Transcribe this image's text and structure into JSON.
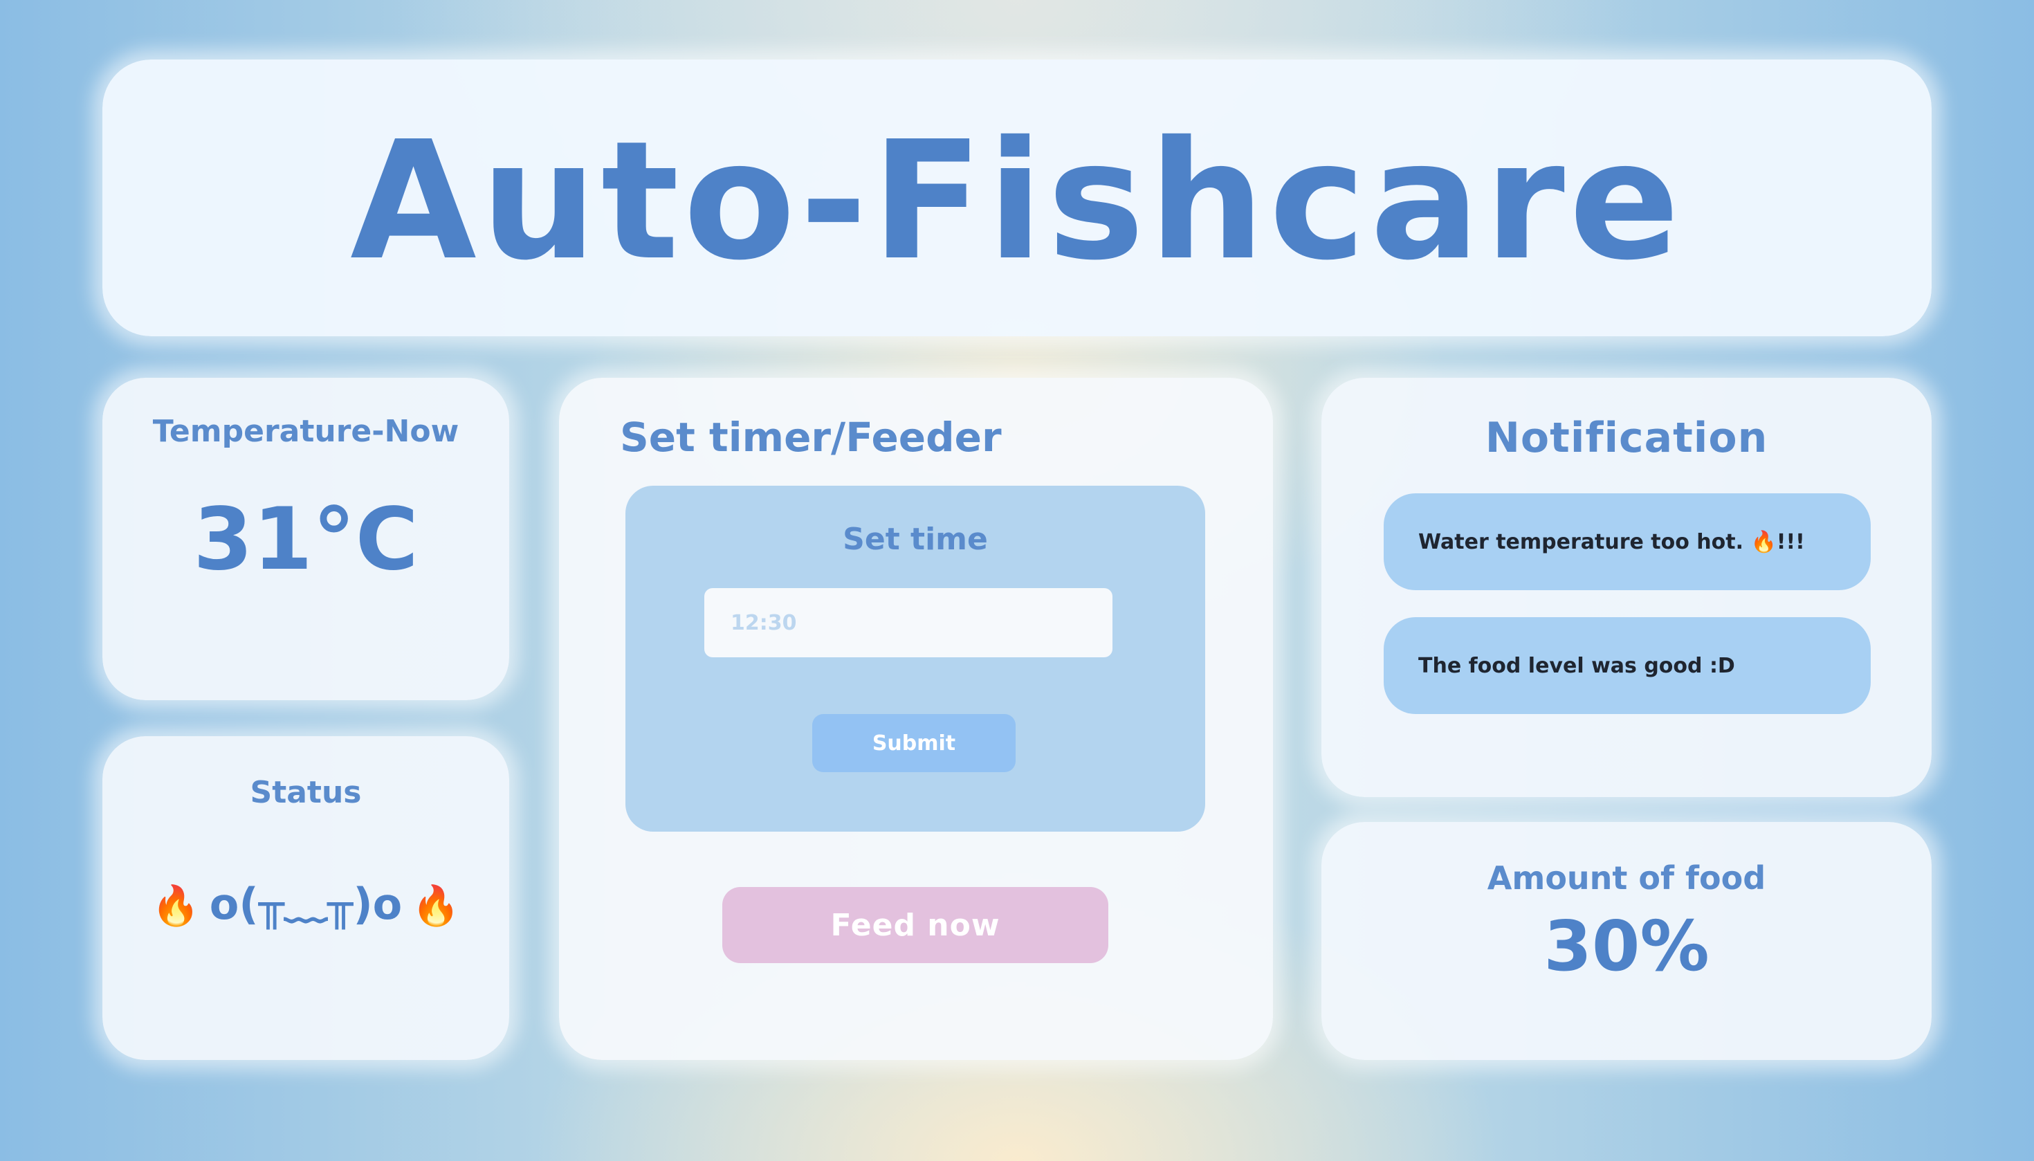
{
  "app": {
    "title": "Auto-Fishcare"
  },
  "temperature": {
    "title": "Temperature-Now",
    "value": "31°C"
  },
  "status": {
    "title": "Status",
    "icon_left": "🔥",
    "face": "o(╥﹏╥)o",
    "icon_right": "🔥"
  },
  "timer": {
    "title": "Set timer/Feeder",
    "panel_title": "Set time",
    "input_value": "",
    "input_placeholder": "12:30",
    "submit_label": "Submit",
    "feed_now_label": "Feed now"
  },
  "notification": {
    "title": "Notification",
    "items": [
      {
        "text": "Water temperature too hot. 🔥!!!"
      },
      {
        "text": "The food level was good :D"
      }
    ]
  },
  "food": {
    "title": "Amount of food",
    "value": "30%",
    "level_fraction": 0.3
  },
  "colors": {
    "accent": "#4e82c8",
    "heading": "#5a8bcc",
    "panel": "#b3d4ef",
    "submit_button": "#93c2f3",
    "feed_button": "#e3c1de",
    "notification_pill": "#a8d0f3"
  }
}
